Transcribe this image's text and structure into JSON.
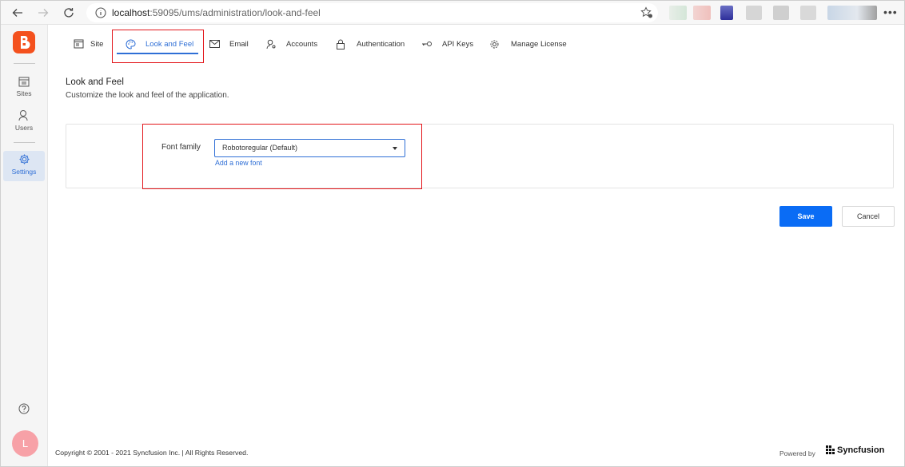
{
  "browser": {
    "url_host": "localhost",
    "url_path": ":59095/ums/administration/look-and-feel"
  },
  "sidebar": {
    "items": [
      {
        "label": "Sites"
      },
      {
        "label": "Users"
      },
      {
        "label": "Settings"
      }
    ],
    "avatar_initial": "L"
  },
  "tabs": [
    {
      "label": "Site"
    },
    {
      "label": "Look and Feel"
    },
    {
      "label": "Email"
    },
    {
      "label": "Accounts"
    },
    {
      "label": "Authentication"
    },
    {
      "label": "API Keys"
    },
    {
      "label": "Manage License"
    }
  ],
  "page": {
    "title": "Look and Feel",
    "subtitle": "Customize the look and feel of the application."
  },
  "font_settings": {
    "label": "Font family",
    "selected": "Robotoregular (Default)",
    "add_link": "Add a new font"
  },
  "actions": {
    "save": "Save",
    "cancel": "Cancel"
  },
  "footer": {
    "copyright": "Copyright © 2001 - 2021 Syncfusion Inc. | All Rights Reserved.",
    "powered_by": "Powered by",
    "brand": "Syncfusion"
  },
  "colors": {
    "accent": "#2f6fd6",
    "primary_button": "#0a6cf5",
    "highlight": "#e3161b",
    "logo": "#f4511e"
  }
}
